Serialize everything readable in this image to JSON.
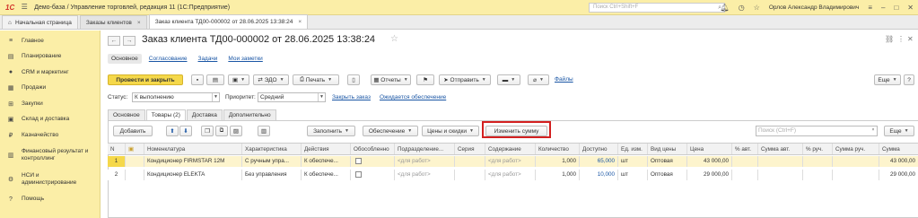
{
  "titlebar": {
    "logo": "1С",
    "app_title": "Демо-база / Управление торговлей, редакция 11  (1С:Предприятие)",
    "search_placeholder": "Поиск Ctrl+Shift+F",
    "user_name": "Орлов Александр Владимирович"
  },
  "window_tabs": [
    {
      "label": "Начальная страница"
    },
    {
      "label": "Заказы клиентов"
    },
    {
      "label": "Заказ клиента ТД00-000002 от 28.06.2025 13:38:24"
    }
  ],
  "sidebar": {
    "items": [
      {
        "label": "Главное",
        "icon": "menu-icon"
      },
      {
        "label": "Планирование",
        "icon": "chart-icon"
      },
      {
        "label": "CRM и маркетинг",
        "icon": "crm-icon"
      },
      {
        "label": "Продажи",
        "icon": "sales-icon"
      },
      {
        "label": "Закупки",
        "icon": "cart-icon"
      },
      {
        "label": "Склад и доставка",
        "icon": "warehouse-icon"
      },
      {
        "label": "Казначейство",
        "icon": "treasury-icon"
      },
      {
        "label": "Финансовый результат и контроллинг",
        "icon": "finance-icon"
      },
      {
        "label": "НСИ и администрирование",
        "icon": "gear-icon"
      },
      {
        "label": "Помощь",
        "icon": "help-icon"
      }
    ]
  },
  "document": {
    "title": "Заказ клиента ТД00-000002 от 28.06.2025 13:38:24",
    "subtabs": [
      "Основное",
      "Согласование",
      "Задачи",
      "Мои заметки"
    ]
  },
  "toolbar": {
    "post_close": "Провести и закрыть",
    "edo": "ЭДО",
    "print": "Печать",
    "reports": "Отчеты",
    "send": "Отправить",
    "files": "Файлы",
    "more": "Еще",
    "help": "?"
  },
  "status_row": {
    "status_label": "Статус:",
    "status_value": "К выполнению",
    "priority_label": "Приоритет:",
    "priority_value": "Средний",
    "close_link": "Закрыть заказ",
    "waiting_link": "Ожидается обеспечение"
  },
  "form_tabs": [
    "Основное",
    "Товары (2)",
    "Доставка",
    "Дополнительно"
  ],
  "goods_toolbar": {
    "add": "Добавить",
    "fill": "Заполнить",
    "provision": "Обеспечение",
    "prices": "Цены и скидки",
    "change_sum": "Изменить сумму",
    "search_placeholder": "Поиск (Ctrl+F)",
    "more": "Еще"
  },
  "table": {
    "columns": [
      "N",
      "Номенклатура",
      "Характеристика",
      "Действия",
      "Обособленно",
      "Подразделение...",
      "Серия",
      "Содержание",
      "Количество",
      "Доступно",
      "Ед. изм.",
      "Вид цены",
      "Цена",
      "% авт.",
      "Сумма авт.",
      "% руч.",
      "Сумма руч.",
      "Сумма"
    ],
    "rows": [
      {
        "n": "1",
        "item": "Кондиционер FIRMSTAR 12M",
        "characteristic": "С ручным упра...",
        "action": "К обеспече...",
        "dept": "<для работ>",
        "series": "",
        "content": "<для работ>",
        "qty": "1,000",
        "available": "65,000",
        "unit": "шт",
        "price_type": "Оптовая",
        "price": "43 000,00",
        "pct_auto": "",
        "sum_auto": "",
        "pct_man": "",
        "sum_man": "",
        "sum": "43 000,00"
      },
      {
        "n": "2",
        "item": "Кондиционер ELEKTA",
        "characteristic": "Без управления",
        "action": "К обеспече...",
        "dept": "<для работ>",
        "series": "",
        "content": "<для работ>",
        "qty": "1,000",
        "available": "10,000",
        "unit": "шт",
        "price_type": "Оптовая",
        "price": "29 000,00",
        "pct_auto": "",
        "sum_auto": "",
        "pct_man": "",
        "sum_man": "",
        "sum": "29 000,00"
      }
    ]
  },
  "colors": {
    "sidebar_bg": "#fbeea7",
    "accent_yellow": "#f5d84a",
    "highlight_red": "#d32020",
    "link_blue": "#1a56a5"
  }
}
